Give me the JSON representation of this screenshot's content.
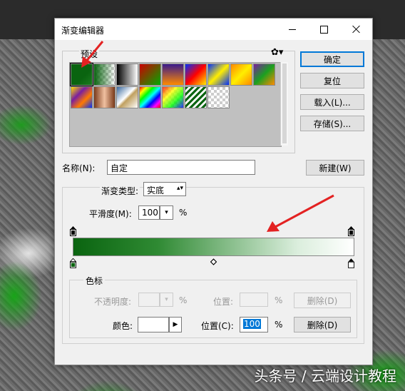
{
  "dialog": {
    "title": "渐变编辑器",
    "buttons": {
      "ok": "确定",
      "reset": "复位",
      "load": "载入(L)...",
      "save": "存储(S)...",
      "new": "新建(W)"
    }
  },
  "presets": {
    "legend": "预设",
    "gear_icon": "gear-icon",
    "swatches": [
      "foreground-to-background",
      "foreground-to-transparent",
      "black-white",
      "red-green",
      "violet-orange",
      "blue-red-yellow",
      "blue-yellow-blue",
      "orange-yellow-orange",
      "violet-green-orange",
      "yellow-violet-orange-blue",
      "copper",
      "chrome",
      "spectrum",
      "transparent-rainbow",
      "transparent-stripes",
      "neutral-density"
    ]
  },
  "name_field": {
    "label": "名称(N):",
    "value": "自定"
  },
  "gradient_type": {
    "label": "渐变类型:",
    "value": "实底"
  },
  "smoothness": {
    "label": "平滑度(M):",
    "value": "100",
    "unit": "%"
  },
  "gradient": {
    "colors": [
      "#0a6410",
      "#ffffff"
    ]
  },
  "stops_group": {
    "legend": "色标",
    "opacity_label": "不透明度:",
    "opacity_unit": "%",
    "opacity_location_label": "位置:",
    "opacity_location_unit": "%",
    "opacity_delete": "删除(D)",
    "color_label": "颜色:",
    "color_location_label": "位置(C):",
    "color_location_value": "100",
    "color_location_unit": "%",
    "color_delete": "删除(D)"
  },
  "watermark": "头条号 / 云端设计教程"
}
